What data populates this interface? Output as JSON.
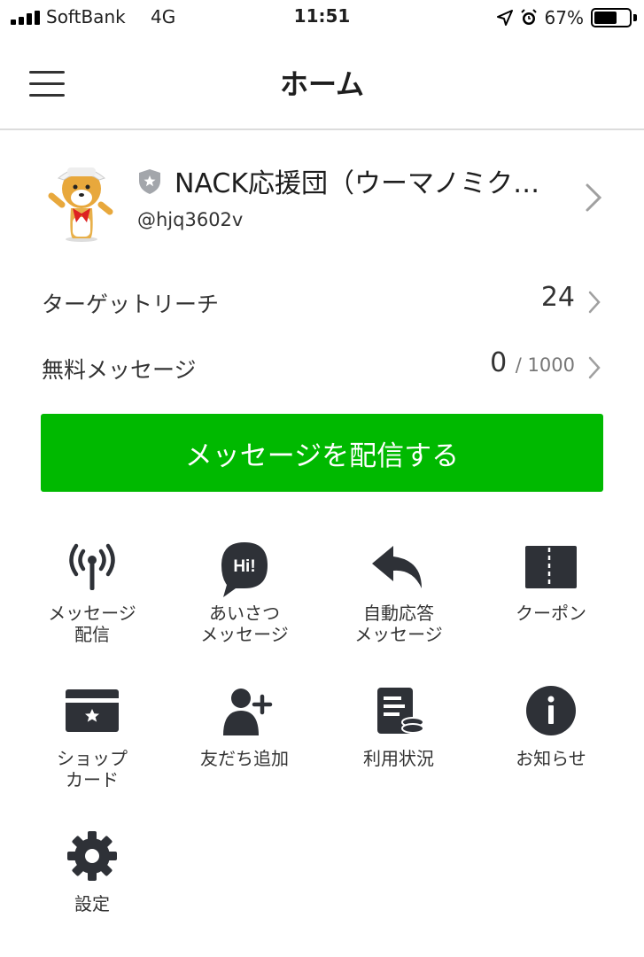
{
  "status_bar": {
    "carrier": "SoftBank",
    "network": "4G",
    "time": "11:51",
    "battery": "67%",
    "battery_level": 0.67
  },
  "header": {
    "title": "ホーム"
  },
  "account": {
    "name": "NACK応援団（ウーマノミク…",
    "id": "@hjq3602v"
  },
  "stats": {
    "target_reach_label": "ターゲットリーチ",
    "target_reach_value": "24",
    "free_messages_label": "無料メッセージ",
    "free_messages_used": "0",
    "free_messages_limit": "/ 1000"
  },
  "cta_label": "メッセージを配信する",
  "menu": [
    {
      "label": "メッセージ\n配信",
      "icon": "broadcast-antenna-icon"
    },
    {
      "label": "あいさつ\nメッセージ",
      "icon": "greeting-bubble-icon",
      "icon_text": "Hi!"
    },
    {
      "label": "自動応答\nメッセージ",
      "icon": "reply-arrow-icon"
    },
    {
      "label": "クーポン",
      "icon": "coupon-icon"
    },
    {
      "label": "ショップ\nカード",
      "icon": "shop-card-icon"
    },
    {
      "label": "友だち追加",
      "icon": "add-friend-icon"
    },
    {
      "label": "利用状況",
      "icon": "usage-report-icon"
    },
    {
      "label": "お知らせ",
      "icon": "info-icon"
    },
    {
      "label": "設定",
      "icon": "gear-icon"
    }
  ],
  "colors": {
    "accent_green": "#00b900",
    "icon_dark": "#2e3137",
    "text": "#333333"
  }
}
